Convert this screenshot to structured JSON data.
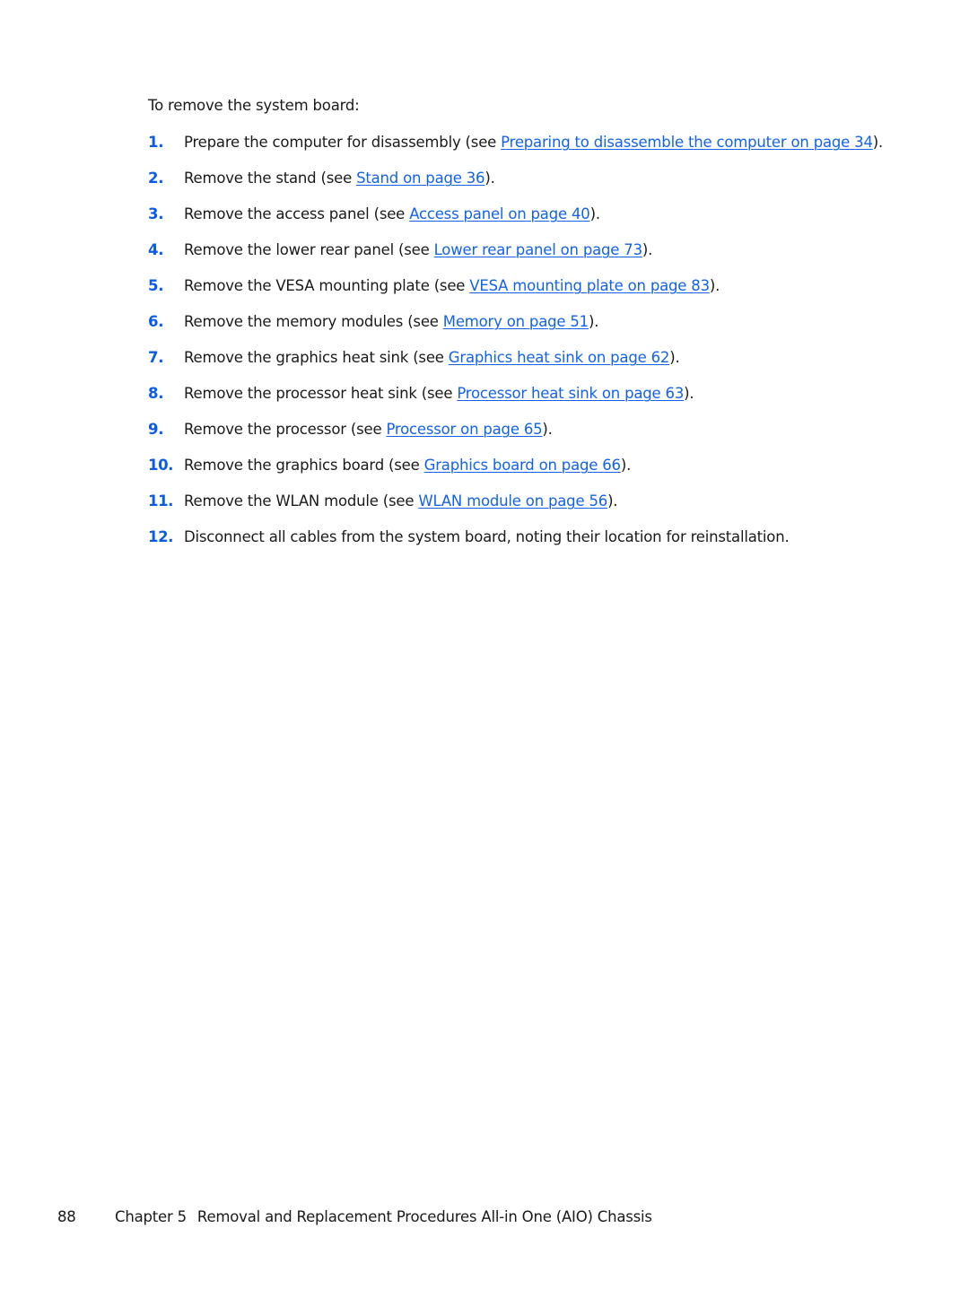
{
  "intro": "To remove the system board:",
  "steps": [
    {
      "num": "1.",
      "before": "Prepare the computer for disassembly (see ",
      "link": "Preparing to disassemble the computer on page 34",
      "after": ")."
    },
    {
      "num": "2.",
      "before": "Remove the stand (see ",
      "link": "Stand on page 36",
      "after": ")."
    },
    {
      "num": "3.",
      "before": "Remove the access panel (see ",
      "link": "Access panel on page 40",
      "after": ")."
    },
    {
      "num": "4.",
      "before": "Remove the lower rear panel (see ",
      "link": "Lower rear panel on page 73",
      "after": ")."
    },
    {
      "num": "5.",
      "before": "Remove the VESA mounting plate (see ",
      "link": "VESA mounting plate on page 83",
      "after": ")."
    },
    {
      "num": "6.",
      "before": "Remove the memory modules (see ",
      "link": "Memory on page 51",
      "after": ")."
    },
    {
      "num": "7.",
      "before": "Remove the graphics heat sink (see ",
      "link": "Graphics heat sink on page 62",
      "after": ")."
    },
    {
      "num": "8.",
      "before": "Remove the processor heat sink (see ",
      "link": "Processor heat sink on page 63",
      "after": ")."
    },
    {
      "num": "9.",
      "before": "Remove the processor (see ",
      "link": "Processor on page 65",
      "after": ")."
    },
    {
      "num": "10.",
      "before": "Remove the graphics board (see ",
      "link": "Graphics board on page 66",
      "after": ")."
    },
    {
      "num": "11.",
      "before": "Remove the WLAN module (see ",
      "link": "WLAN module on page 56",
      "after": ")."
    },
    {
      "num": "12.",
      "before": "Disconnect all cables from the system board, noting their location for reinstallation.",
      "link": "",
      "after": ""
    }
  ],
  "footer": {
    "page_number": "88",
    "chapter": "Chapter 5",
    "title": "Removal and Replacement Procedures All-in One (AIO) Chassis"
  },
  "colors": {
    "step_number": "#0a5ce8",
    "link": "#1463e6",
    "text": "#1a1a1a"
  }
}
